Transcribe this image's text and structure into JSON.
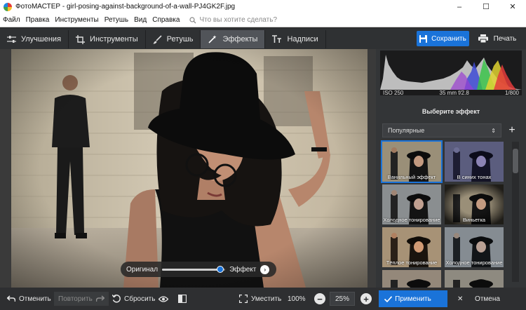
{
  "window": {
    "title": "ФотоМАСТЕР - girl-posing-against-background-of-a-wall-PJ4GK2F.jpg",
    "minimize": "–",
    "maximize": "☐",
    "close": "✕"
  },
  "menu": {
    "items": [
      "Файл",
      "Правка",
      "Инструменты",
      "Ретушь",
      "Вид",
      "Справка"
    ],
    "search_placeholder": "Что вы хотите сделать?"
  },
  "toolbar": {
    "tabs": [
      {
        "label": "Улучшения",
        "icon": "sliders-icon",
        "active": false
      },
      {
        "label": "Инструменты",
        "icon": "crop-icon",
        "active": false
      },
      {
        "label": "Ретушь",
        "icon": "brush-icon",
        "active": false
      },
      {
        "label": "Эффекты",
        "icon": "magic-wand-icon",
        "active": true
      },
      {
        "label": "Надписи",
        "icon": "text-icon",
        "active": false
      }
    ],
    "save_label": "Сохранить",
    "print_label": "Печать"
  },
  "compare": {
    "left_label": "Оригинал",
    "right_label": "Эффект",
    "value": 0.92
  },
  "panel": {
    "exif": {
      "iso": "ISO 250",
      "lens": "35 mm f/2.8",
      "shutter": "1/800"
    },
    "title": "Выберите эффект",
    "category": "Популярные",
    "category_arrows": "⇕",
    "add": "+",
    "effects": [
      {
        "label": "Ванильный эффект",
        "selected": true
      },
      {
        "label": "В синих тонах",
        "selected": false
      },
      {
        "label": "Холодное тонирование",
        "selected": false
      },
      {
        "label": "Виньетка",
        "selected": false
      },
      {
        "label": "Тёплое тонирование",
        "selected": false
      },
      {
        "label": "Холодное тонирование",
        "selected": false
      },
      {
        "label": "",
        "selected": false
      },
      {
        "label": "",
        "selected": false
      }
    ]
  },
  "bottom": {
    "undo": "Отменить",
    "redo": "Повторить",
    "reset": "Сбросить",
    "fit": "Уместить",
    "zoom_100": "100%",
    "zoom_value": "25%",
    "minus": "−",
    "plus": "+",
    "apply": "Применить",
    "cancel": "Отмена"
  },
  "colors": {
    "accent": "#1a73d9",
    "toolbar": "#2f3133",
    "panel": "#333537"
  }
}
